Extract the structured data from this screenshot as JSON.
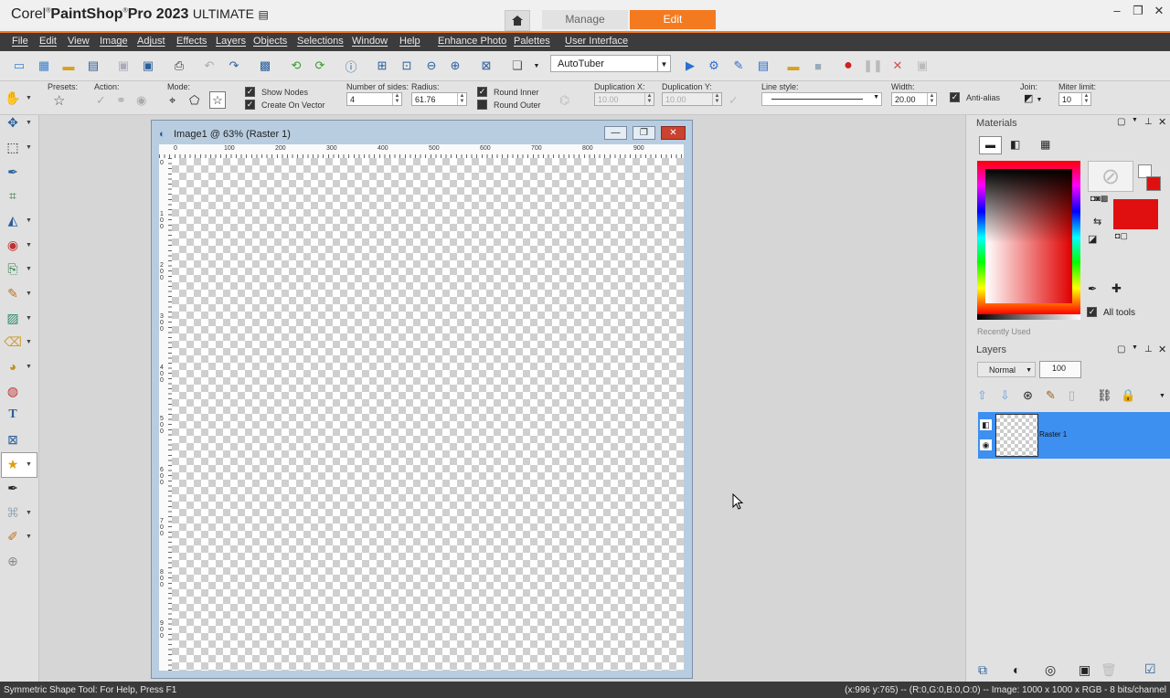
{
  "app": {
    "title_prefix": "Corel",
    "title_brand": "PaintShop",
    "title_pro": "Pro 2023",
    "title_edition": "ULTIMATE"
  },
  "workspace_tabs": {
    "manage": "Manage",
    "edit": "Edit"
  },
  "menu": [
    "File",
    "Edit",
    "View",
    "Image",
    "Adjust",
    "Effects",
    "Layers",
    "Objects",
    "Selections",
    "Window",
    "Help",
    "Enhance Photo",
    "Palettes",
    "User Interface"
  ],
  "toolbar": {
    "script_value": "AutoTuber"
  },
  "tool_options": {
    "presets_label": "Presets:",
    "action_label": "Action:",
    "mode_label": "Mode:",
    "show_nodes": "Show Nodes",
    "create_on_vector": "Create On Vector",
    "sides_label": "Number of sides:",
    "sides_value": "4",
    "radius_label": "Radius:",
    "radius_value": "61.76",
    "round_inner": "Round Inner",
    "round_outer": "Round Outer",
    "dup_x_label": "Duplication X:",
    "dup_x_value": "10.00",
    "dup_y_label": "Duplication Y:",
    "dup_y_value": "10.00",
    "line_style_label": "Line style:",
    "width_label": "Width:",
    "width_value": "20.00",
    "anti_alias": "Anti-alias",
    "join_label": "Join:",
    "miter_label": "Miter limit:",
    "miter_value": "10"
  },
  "image_window": {
    "title": "Image1 @  63% (Raster 1)",
    "hruler": [
      "0",
      "100",
      "200",
      "300",
      "400",
      "500",
      "600",
      "700",
      "800",
      "900"
    ],
    "vruler": [
      "0",
      "100",
      "200",
      "300",
      "400",
      "500",
      "600",
      "700",
      "800",
      "900"
    ]
  },
  "materials": {
    "title": "Materials",
    "all_tools": "All tools",
    "recently_used": "Recently Used",
    "fg_color": "#e01010"
  },
  "layers": {
    "title": "Layers",
    "blend_mode": "Normal",
    "opacity": "100",
    "layer_name": "Raster 1"
  },
  "status": {
    "left": "Symmetric Shape Tool: For Help, Press F1",
    "right": "(x:996 y:765) -- (R:0,G:0,B:0,O:0) -- Image:  1000 x 1000 x RGB - 8 bits/channel"
  },
  "colors": {
    "accent": "#f47a20",
    "selection": "#3d8ff0"
  }
}
